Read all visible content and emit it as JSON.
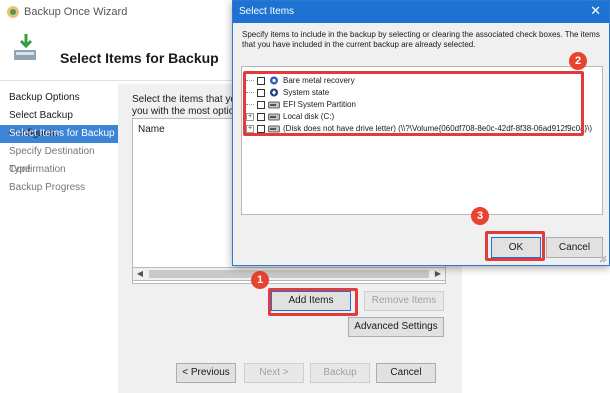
{
  "wizard": {
    "window_title": "Backup Once Wizard",
    "header_title": "Select Items for Backup",
    "nav": [
      {
        "label": "Backup Options",
        "state": "normal"
      },
      {
        "label": "Select Backup Configurat...",
        "state": "normal"
      },
      {
        "label": "Select Items for Backup",
        "state": "active"
      },
      {
        "label": "Specify Destination Type",
        "state": "disabled"
      },
      {
        "label": "Confirmation",
        "state": "disabled"
      },
      {
        "label": "Backup Progress",
        "state": "disabled"
      }
    ],
    "instruction_line1": "Select the items that you w",
    "instruction_line2": "you with the most options",
    "list_column": "Name",
    "buttons": {
      "add_items": "Add Items",
      "remove_items": "Remove Items",
      "advanced_settings": "Advanced Settings",
      "previous": "< Previous",
      "next": "Next >",
      "backup": "Backup",
      "cancel": "Cancel"
    }
  },
  "dialog": {
    "title": "Select Items",
    "close_glyph": "✕",
    "description": "Specify items to include in the backup by selecting or clearing the associated check boxes. The items that you have included in the current backup are already selected.",
    "items": [
      {
        "label": "Bare metal recovery",
        "checked": false,
        "expandable": false,
        "icon": "bare-metal-icon"
      },
      {
        "label": "System state",
        "checked": false,
        "expandable": false,
        "icon": "system-state-icon"
      },
      {
        "label": "EFI System Partition",
        "checked": false,
        "expandable": false,
        "icon": "drive-icon"
      },
      {
        "label": "Local disk (C:)",
        "checked": false,
        "expandable": true,
        "icon": "drive-icon"
      },
      {
        "label": "(Disk does not have drive letter) (\\\\?\\Volume{060df708-8e0c-42df-8f38-06ad912f9c0a}\\)",
        "checked": false,
        "expandable": true,
        "icon": "drive-icon"
      }
    ],
    "ok": "OK",
    "cancel": "Cancel"
  },
  "annotations": {
    "badge1": "1",
    "badge2": "2",
    "badge3": "3",
    "highlight_color": "#e23b3b",
    "badge_color": "#e8432f"
  },
  "colors": {
    "accent": "#3b84d6",
    "dialog_title": "#1e73d2"
  }
}
